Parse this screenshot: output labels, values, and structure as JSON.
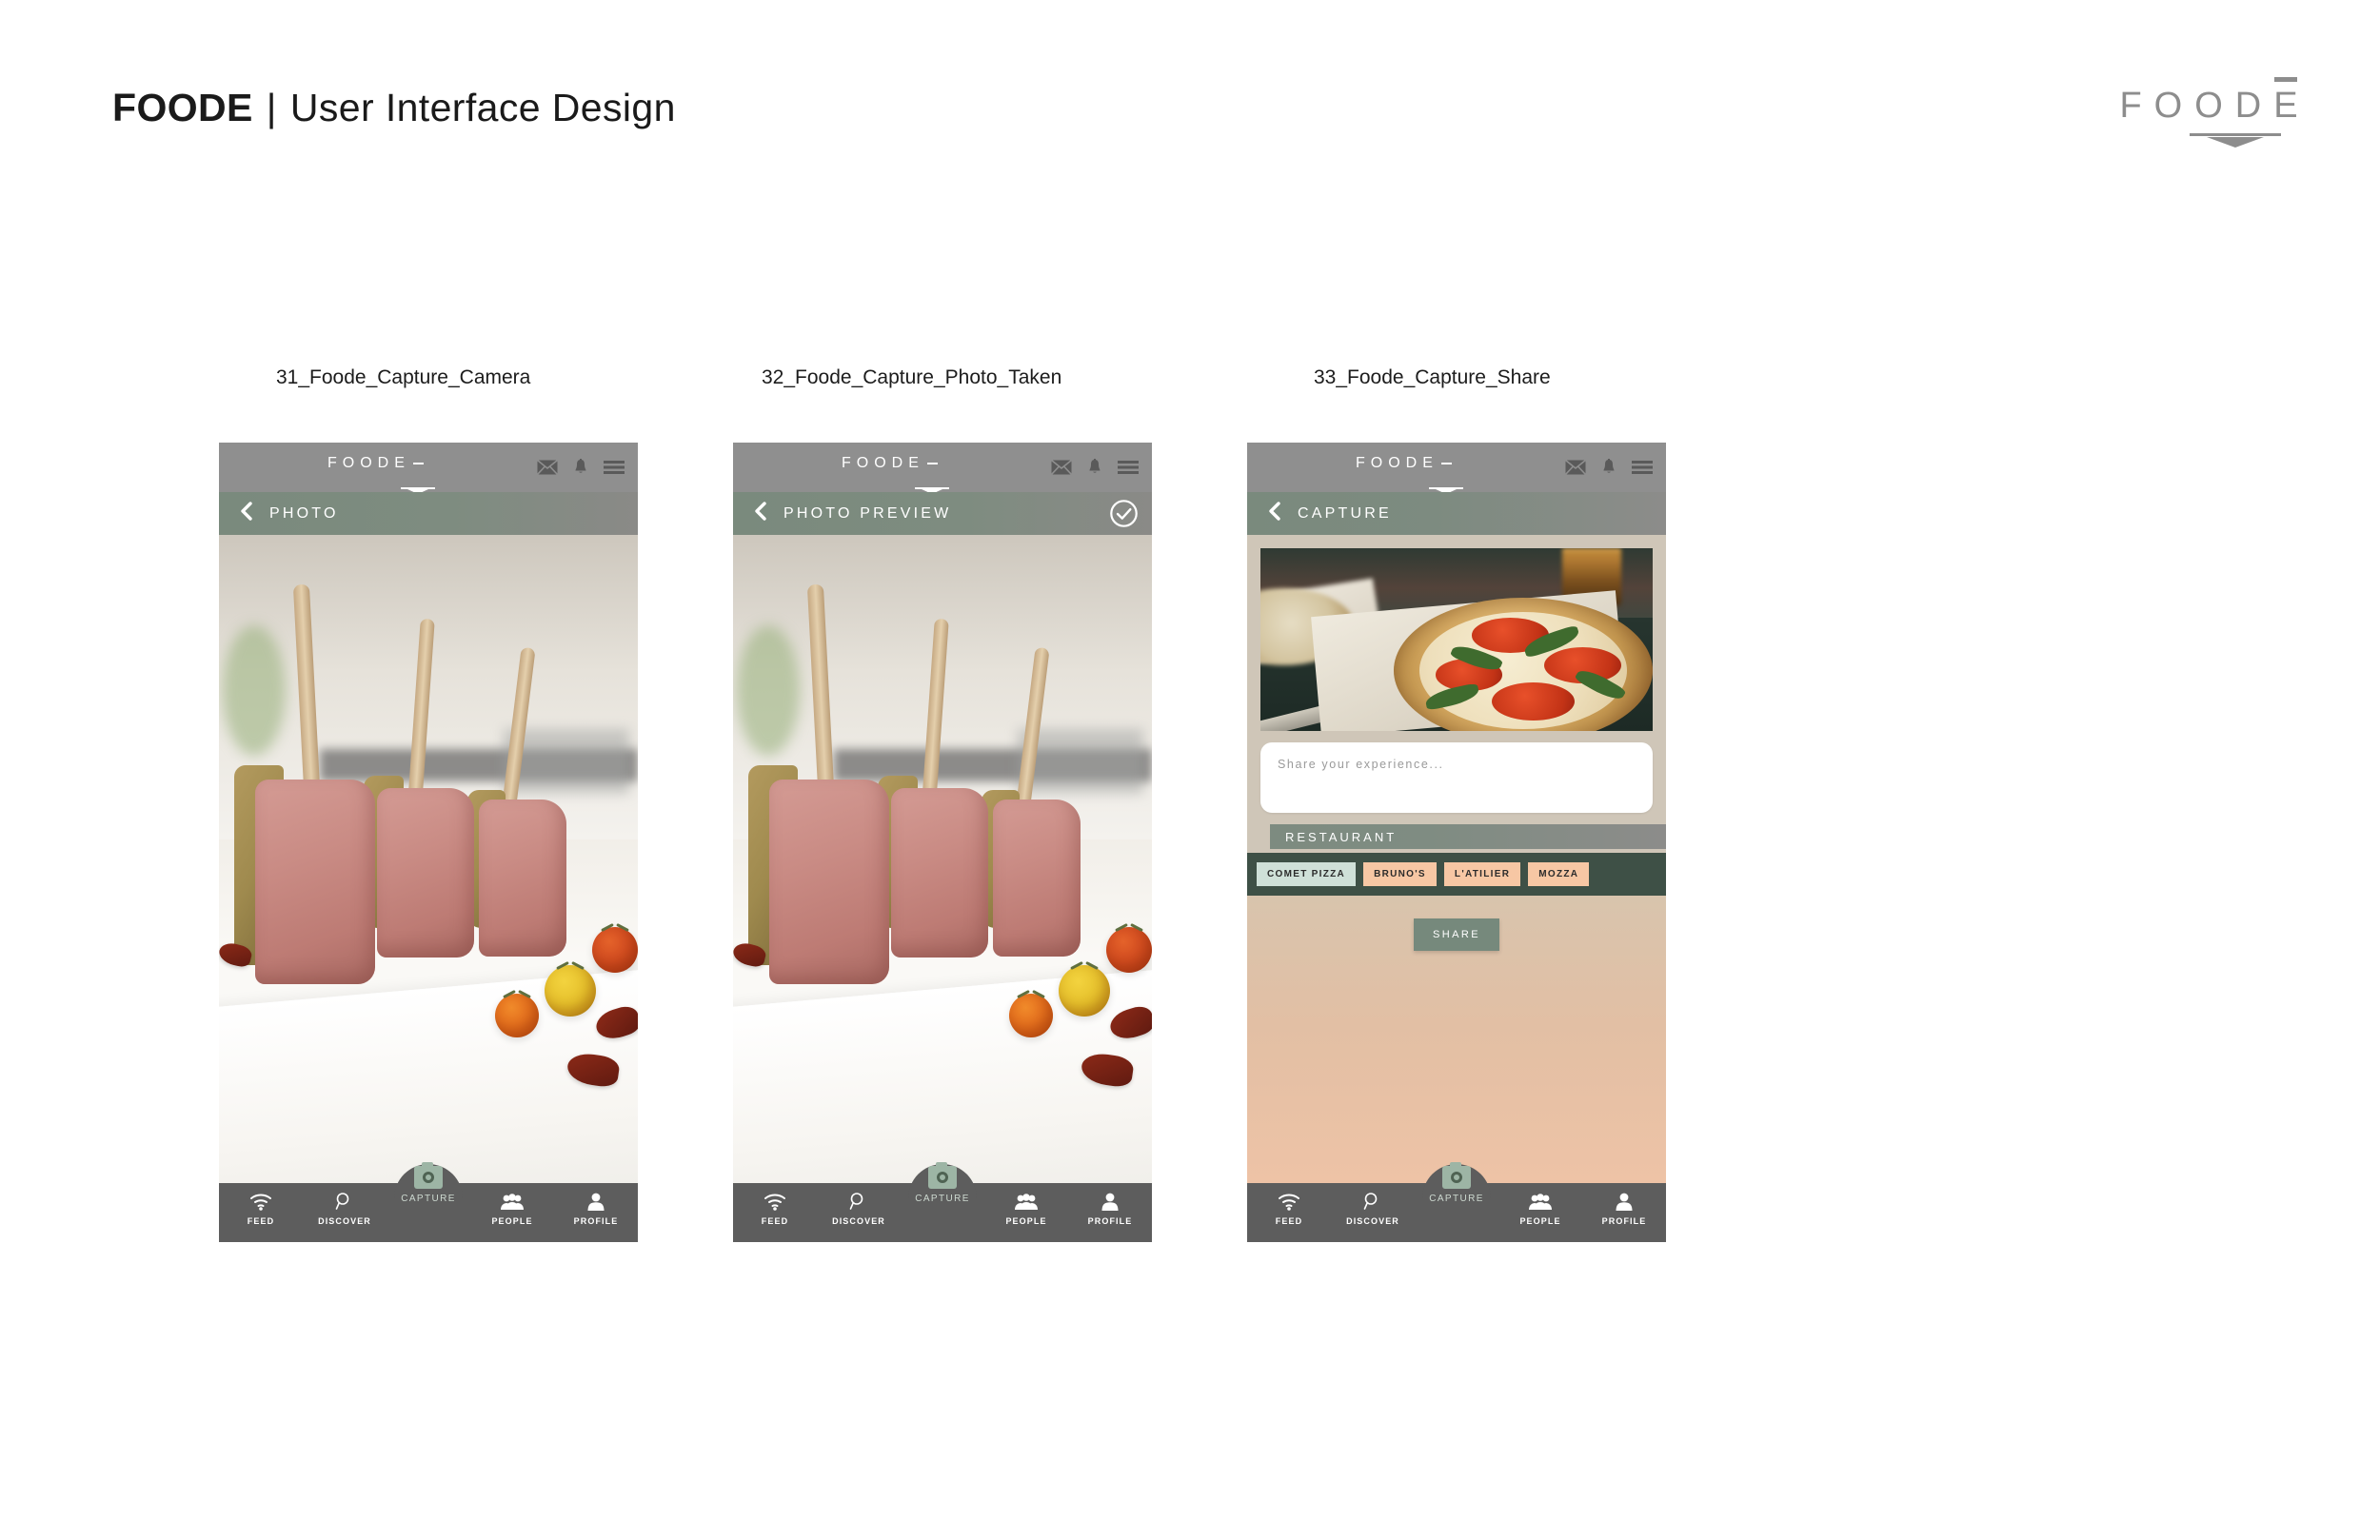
{
  "slide": {
    "title_bold": "FOODE",
    "title_sep": "|",
    "title_rest": "User Interface Design",
    "brand_wordmark": "FOODE",
    "brand_name": "FOODĒ"
  },
  "screens": [
    {
      "caption": "31_Foode_Capture_Camera",
      "appbar": {
        "logo": "FOODE",
        "mail_icon": "envelope-icon",
        "bell_icon": "bell-icon",
        "menu_icon": "hamburger-menu-icon"
      },
      "subbar": {
        "back_icon": "chevron-left-icon",
        "title": "PHOTO",
        "confirm_icon": null
      },
      "content_type": "camera-viewfinder",
      "photo_alt": "Herb crusted rack of lamb chops with cherry tomatoes on white plate"
    },
    {
      "caption": "32_Foode_Capture_Photo_Taken",
      "appbar": {
        "logo": "FOODE",
        "mail_icon": "envelope-icon",
        "bell_icon": "bell-icon",
        "menu_icon": "hamburger-menu-icon"
      },
      "subbar": {
        "back_icon": "chevron-left-icon",
        "title": "PHOTO PREVIEW",
        "confirm_icon": "check-circle-icon"
      },
      "content_type": "photo-preview",
      "photo_alt": "Herb crusted rack of lamb chops with cherry tomatoes on white plate"
    },
    {
      "caption": "33_Foode_Capture_Share",
      "appbar": {
        "logo": "FOODE",
        "mail_icon": "envelope-icon",
        "bell_icon": "bell-icon",
        "menu_icon": "hamburger-menu-icon"
      },
      "subbar": {
        "back_icon": "chevron-left-icon",
        "title": "CAPTURE",
        "confirm_icon": null
      },
      "content_type": "share-form",
      "photo_alt": "Margherita pizza with basil on paper lined tray",
      "composer_placeholder": "Share your experience...",
      "composer_value": "",
      "section_label": "RESTAURANT",
      "restaurant_tags": [
        {
          "label": "COMET PIZZA",
          "selected": true
        },
        {
          "label": "BRUNO'S",
          "selected": false
        },
        {
          "label": "L'ATILIER",
          "selected": false
        },
        {
          "label": "MOZZA",
          "selected": false
        }
      ],
      "share_button": "SHARE"
    }
  ],
  "tabbar": {
    "items": [
      {
        "label": "FEED",
        "icon": "wifi-icon",
        "active": false
      },
      {
        "label": "DISCOVER",
        "icon": "search-icon",
        "active": false
      },
      {
        "label": "CAPTURE",
        "icon": "camera-icon",
        "active": true
      },
      {
        "label": "PEOPLE",
        "icon": "people-icon",
        "active": false
      },
      {
        "label": "PROFILE",
        "icon": "person-icon",
        "active": false
      }
    ]
  },
  "colors": {
    "appbar_gray": "#8f8f8f",
    "subbar_sage": "#7d8b80",
    "tabbar_gray": "#5d5d5d",
    "tag_peach": "#f7c7a4",
    "tag_mint": "#cfe0d8",
    "tag_row_green": "#3e5046",
    "share_button": "#76897c",
    "canvas_tan": "#cfc6b8",
    "logo_gray": "#8d8d8d"
  }
}
